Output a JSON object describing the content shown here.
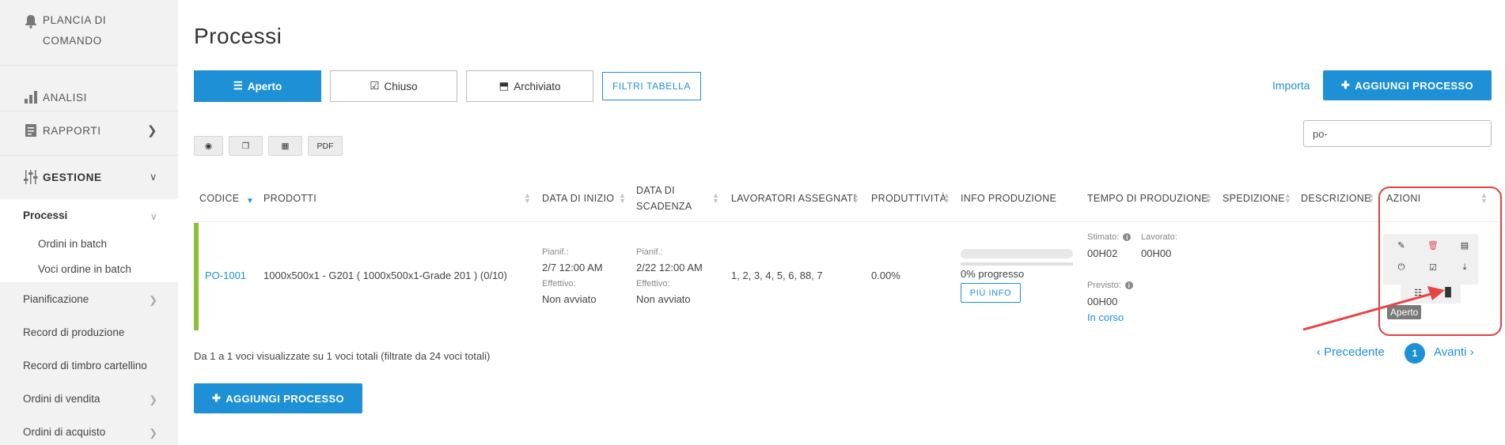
{
  "sidebar": {
    "dashboard": "PLANCIA DI COMANDO",
    "analysis": "ANALISI",
    "reports": "RAPPORTI",
    "management": "GESTIONE",
    "processes": "Processi",
    "batch_orders": "Ordini in batch",
    "batch_order_items": "Voci ordine in batch",
    "planning": "Pianificazione",
    "production_records": "Record di produzione",
    "timecard_records": "Record di timbro cartellino",
    "sales_orders": "Ordini di vendita",
    "purchase_orders": "Ordini di acquisto"
  },
  "page": {
    "title": "Processi"
  },
  "tabs": {
    "open": "Aperto",
    "closed": "Chiuso",
    "archived": "Archiviato"
  },
  "filters_label": "FILTRI TABELLA",
  "import_label": "Importa",
  "add_process_label": "AGGIUNGI PROCESSO",
  "tools": {
    "pdf": "PDF"
  },
  "search": {
    "value": "po-"
  },
  "table": {
    "headers": {
      "code": "CODICE",
      "products": "PRODOTTI",
      "start_date": "DATA DI INIZIO",
      "due_date_1": "DATA DI",
      "due_date_2": "SCADENZA",
      "workers": "LAVORATORI ASSEGNATI",
      "productivity": "PRODUTTIVITÀ",
      "prod_info": "INFO PRODUZIONE",
      "prod_time": "TEMPO DI PRODUZIONE",
      "shipping": "SPEDIZIONE",
      "description": "DESCRIZIONE",
      "actions": "AZIONI"
    },
    "row": {
      "code": "PO-1001",
      "product": "1000x500x1 - G201 ( 1000x500x1-Grade 201 ) (0/10)",
      "planned_label": "Pianif.:",
      "actual_label": "Effettivo:",
      "start_planned": "2/7   12:00 AM",
      "start_actual": "Non avviato",
      "due_planned": "2/22   12:00 AM",
      "due_actual": "Non avviato",
      "workers": "1, 2, 3, 4, 5, 6, 88, 7",
      "productivity": "0.00%",
      "progress_text": "0% progresso",
      "progress": 0,
      "more_info": "PIÙ INFO",
      "estimated_label": "Stimato:",
      "worked_label": "Lavorato:",
      "estimated_value": "00H02",
      "worked_value": "00H00",
      "expected_label": "Previsto:",
      "expected_value": "00H00",
      "status": "In corso"
    },
    "tooltip": "Aperto"
  },
  "footer": {
    "info": "Da 1 a 1 voci visualizzate su 1 voci totali (filtrate da 24 voci totali)",
    "prev": "Precedente",
    "page": "1",
    "next": "Avanti"
  },
  "colors": {
    "accent": "#1e90d6",
    "row_status": "#8bbf3a",
    "highlight": "#e04040"
  }
}
